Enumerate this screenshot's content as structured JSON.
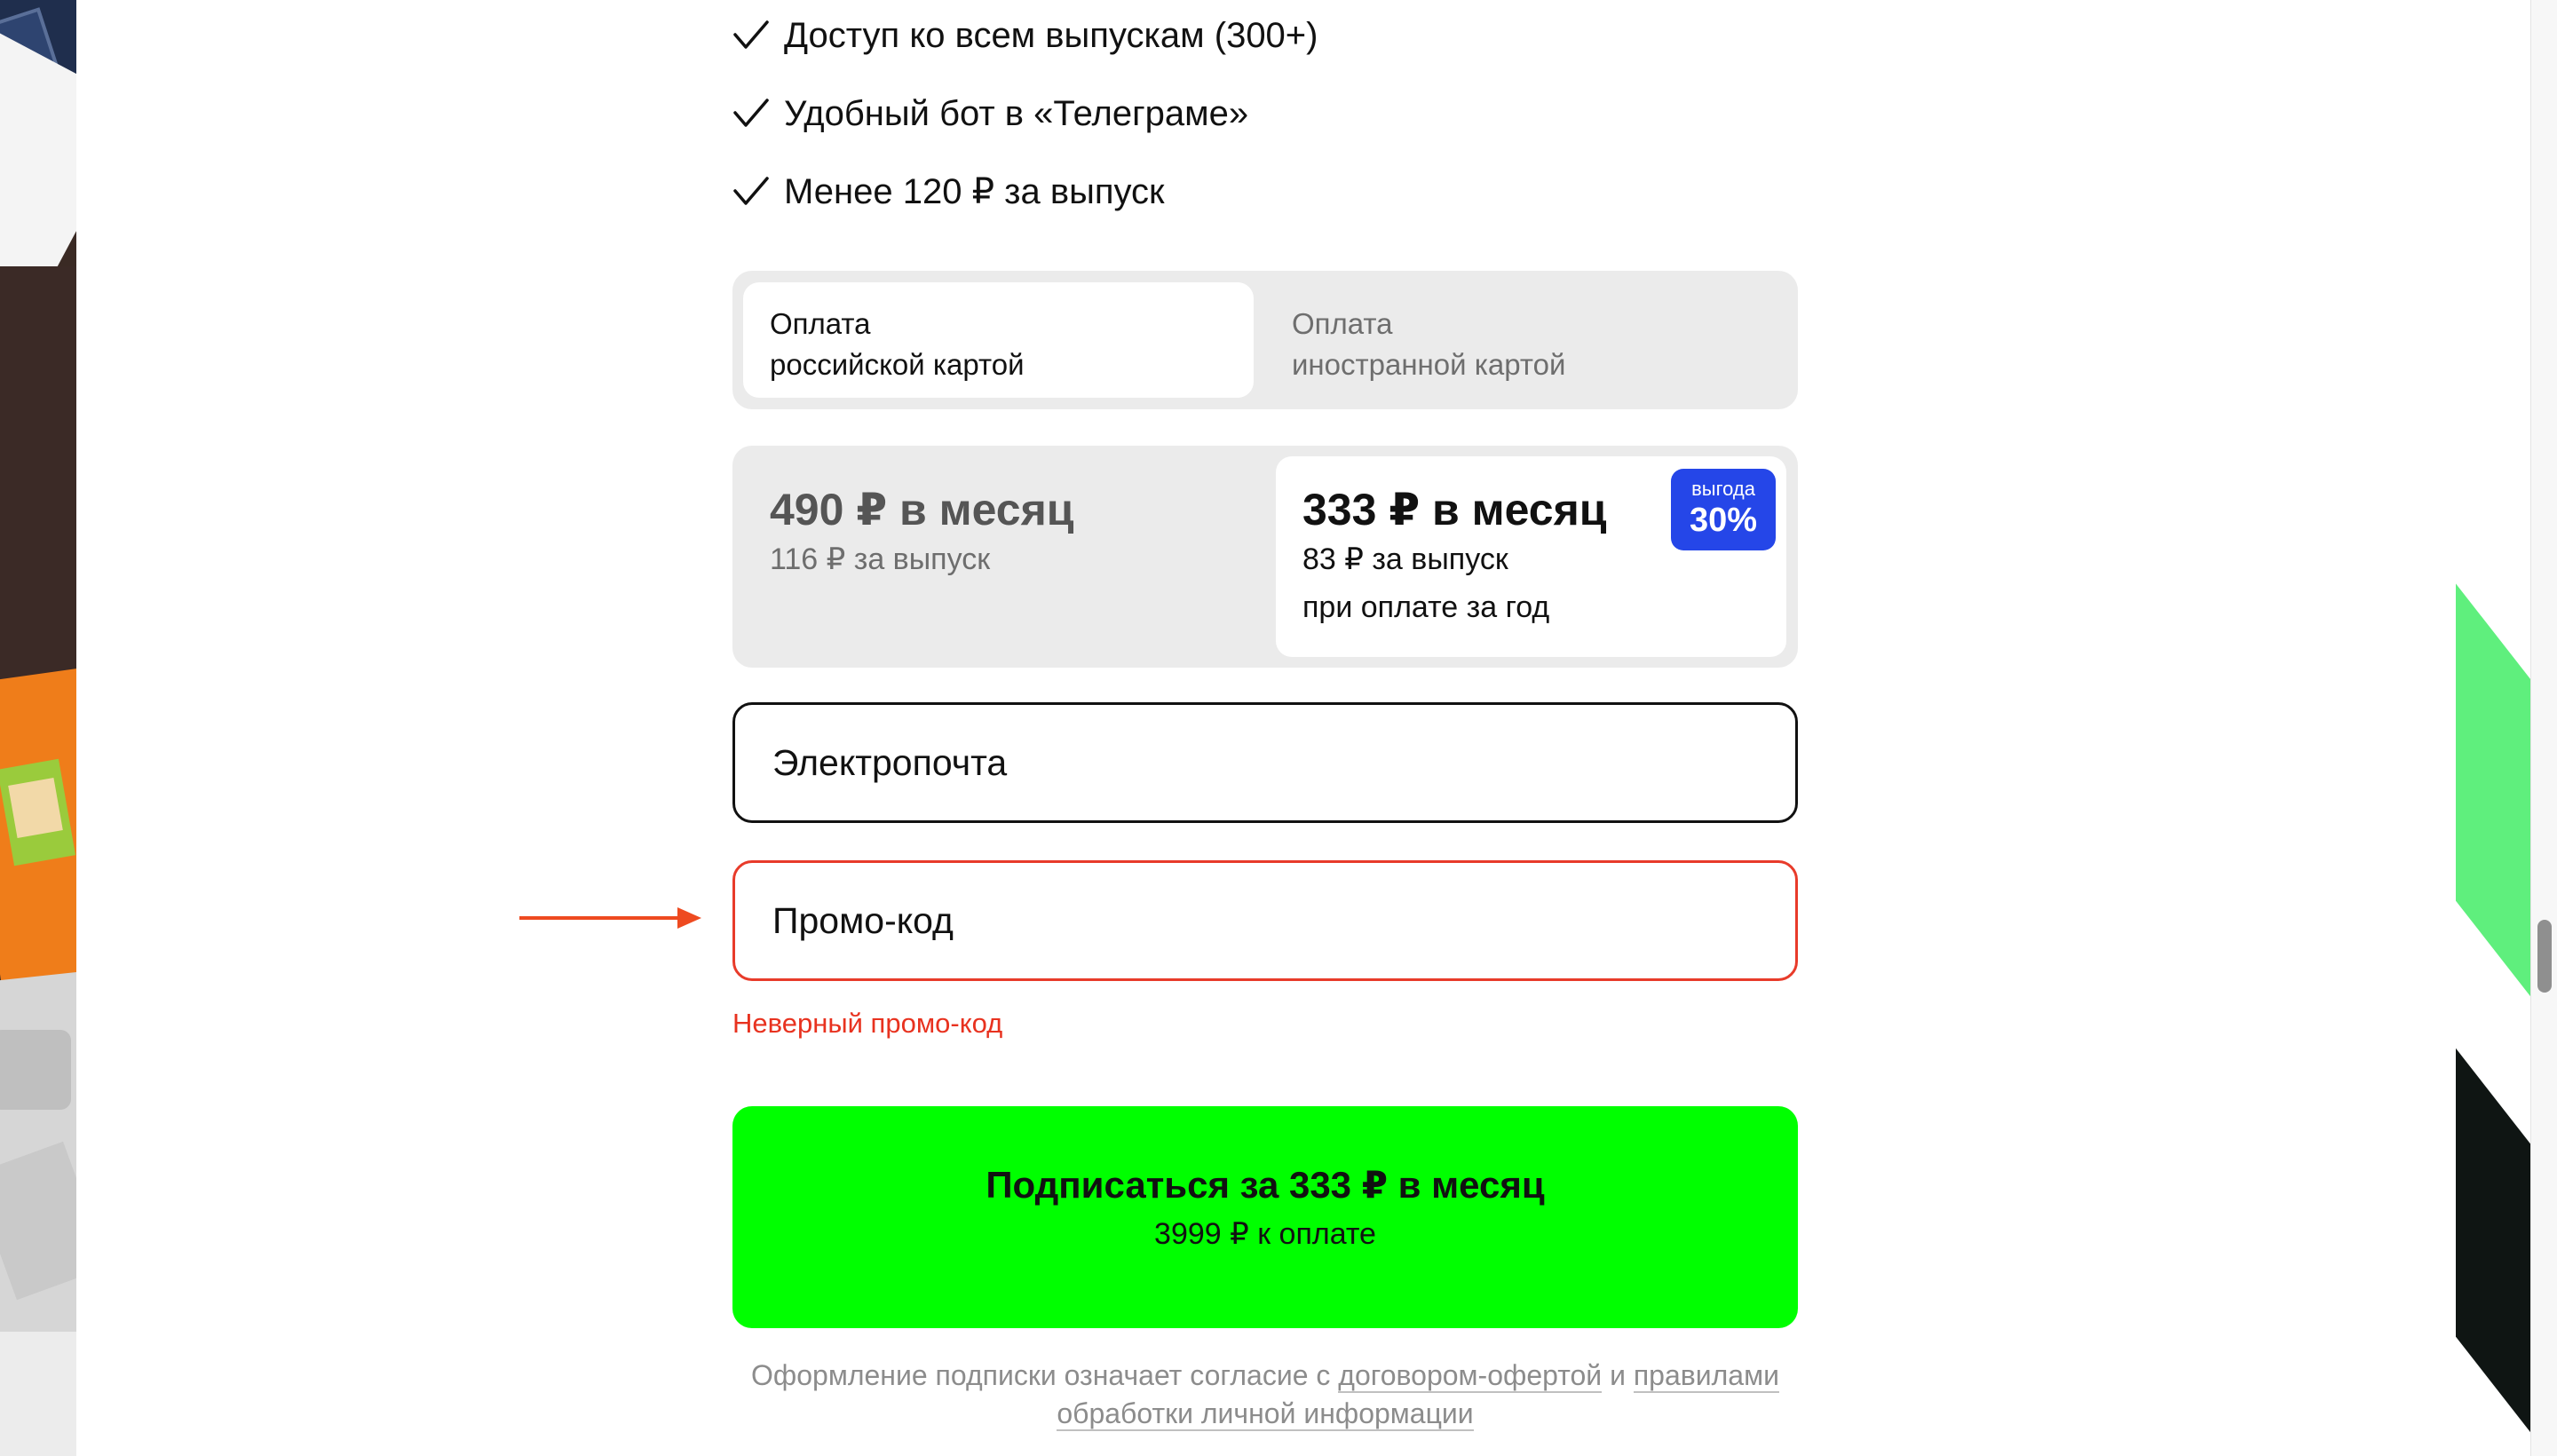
{
  "features": [
    {
      "text": "Доступ ко всем выпускам (300+)",
      "icon": "check-icon"
    },
    {
      "text": "Удобный бот в «Телеграме»",
      "icon": "check-icon"
    },
    {
      "text": "Менее 120 ₽ за выпуск",
      "icon": "check-icon"
    }
  ],
  "payment_toggle": {
    "options": [
      {
        "line1": "Оплата",
        "line2": "российской картой",
        "selected": true
      },
      {
        "line1": "Оплата",
        "line2": "иностранной картой",
        "selected": false
      }
    ]
  },
  "plans": {
    "monthly": {
      "price": "490 ₽ в месяц",
      "per_issue": "116 ₽ за выпуск",
      "selected": false
    },
    "yearly": {
      "price": "333 ₽ в месяц",
      "per_issue": "83 ₽ за выпуск",
      "note": "при оплате за год",
      "selected": true,
      "badge": {
        "label": "выгода",
        "value": "30%"
      }
    }
  },
  "form": {
    "email_placeholder": "Электропочта",
    "promo_placeholder": "Промо-код",
    "promo_error": "Неверный промо-код"
  },
  "subscribe_button": {
    "label": "Подписаться за 333 ₽ в месяц",
    "sublabel": "3999 ₽ к оплате"
  },
  "legal": {
    "prefix": "Оформление подписки означает согласие с ",
    "link1": "договором-офертой",
    "middle": " и ",
    "link2_part1": "правилами",
    "link2_part2": "обработки личной информации"
  },
  "colors": {
    "accent_green": "#00ff00",
    "badge_blue": "#2546e8",
    "error_red": "#e8321f"
  }
}
